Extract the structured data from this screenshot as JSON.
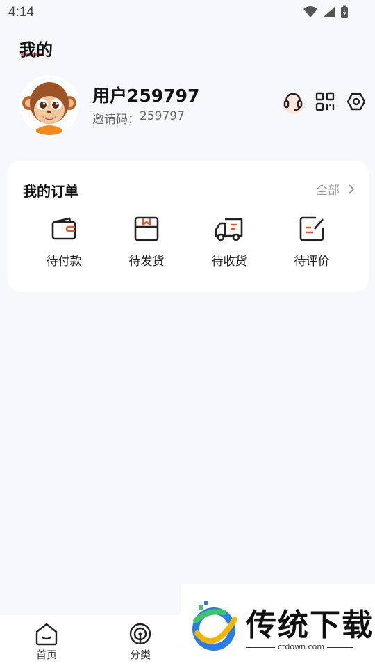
{
  "status_bar": {
    "time": "4:14"
  },
  "header": {
    "title": "我的"
  },
  "profile": {
    "username": "用户259797",
    "invite_label": "邀请码：",
    "invite_code": "259797"
  },
  "header_icons": [
    "headset-icon",
    "qr-code-icon",
    "settings-icon"
  ],
  "orders": {
    "title": "我的订单",
    "all_label": "全部",
    "items": [
      {
        "label": "待付款",
        "icon": "wallet-icon"
      },
      {
        "label": "待发货",
        "icon": "package-icon"
      },
      {
        "label": "待收货",
        "icon": "delivery-truck-icon"
      },
      {
        "label": "待评价",
        "icon": "review-icon"
      }
    ]
  },
  "bottom_nav": [
    {
      "label": "首页",
      "icon": "home-icon"
    },
    {
      "label": "分类",
      "icon": "category-icon"
    }
  ],
  "watermark": {
    "brand": "传统下载",
    "url": "ctdown.com"
  },
  "colors": {
    "accent": "#e8542a",
    "background": "#f7f8fb",
    "card": "#ffffff"
  }
}
